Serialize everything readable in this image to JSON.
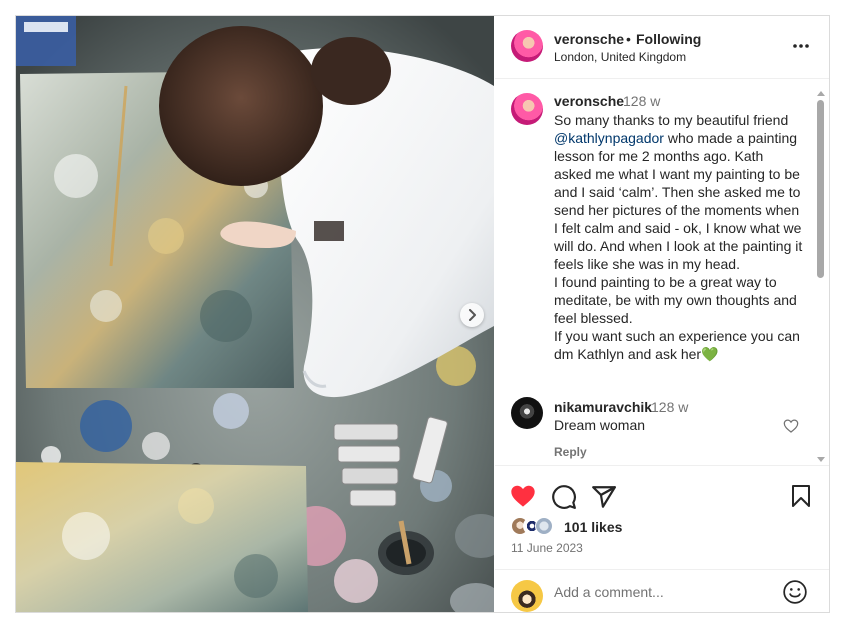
{
  "post": {
    "username": "veronsche",
    "separator": "•",
    "follow_status": "Following",
    "location": "London, United Kingdom"
  },
  "caption": {
    "username": "veronsche",
    "time": "128 w",
    "text_before": "So many thanks to my beautiful friend ",
    "mention": "@kathlynpagador",
    "text_after": " who made a painting lesson for me 2 months ago. Kath asked me what I want my painting to be and I said ‘calm’. Then she asked me to send her pictures of the moments when I felt calm and said - ok, I know what we will do.  And when I look at the painting it feels like she was in my head.\nI found painting to be a great way to meditate, be with my own thoughts and feel blessed.\nIf you want such an experience you can dm Kathlyn and ask her",
    "emoji": "💚"
  },
  "comment": {
    "username": "nikamuravchik",
    "time": "128 w",
    "text": "Dream woman",
    "reply_label": "Reply"
  },
  "stats": {
    "likes": "101 likes",
    "date": "11 June 2023"
  },
  "add_comment": {
    "placeholder": "Add a comment..."
  },
  "icons": {
    "like": "heart-filled-icon",
    "comment": "speech-bubble-icon",
    "share": "paper-plane-icon",
    "save": "bookmark-icon",
    "more": "more-horizontal-icon",
    "emoji": "smiley-icon",
    "carousel_next": "chevron-right-icon"
  },
  "colors": {
    "like_red": "#ff3040",
    "mention_blue": "#00376b",
    "secondary_text": "#737373",
    "border": "#dbdbdb"
  }
}
